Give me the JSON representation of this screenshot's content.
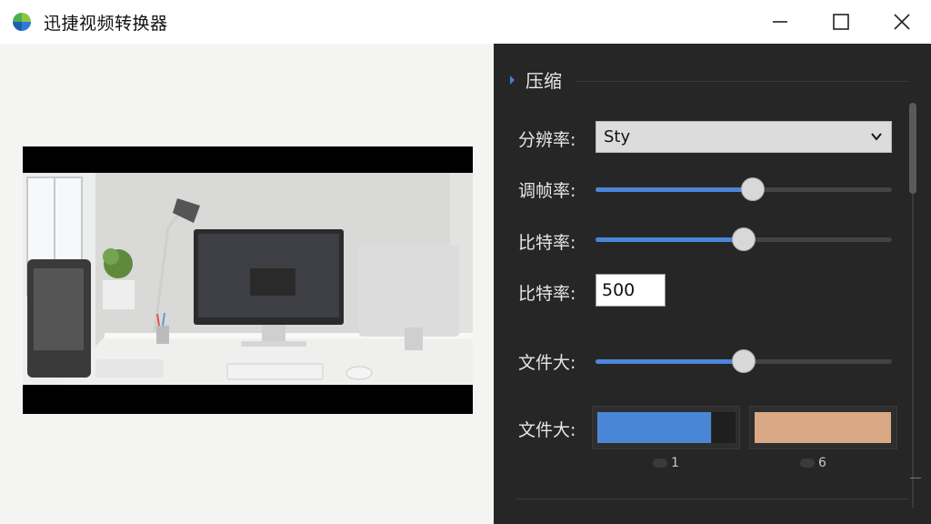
{
  "window": {
    "title": "迅捷视频转换器",
    "controls": {
      "minimize_icon": "minimize-icon",
      "maximize_icon": "maximize-icon",
      "close_icon": "close-icon"
    }
  },
  "preview": {
    "image": "office-desk-with-monitors"
  },
  "panel": {
    "section_title": "压缩",
    "resolution": {
      "label": "分辨率:",
      "value": "Sty"
    },
    "framerate": {
      "label": "调帧率:",
      "value": 0.53
    },
    "bitrate_slider": {
      "label": "比特率:",
      "value": 0.5
    },
    "bitrate_input": {
      "label": "比特率:",
      "value": "500"
    },
    "filesize_slider": {
      "label": "文件大:",
      "value": 0.5
    },
    "filesize_swatch": {
      "label": "文件大:",
      "swatch_a": {
        "color": "#4a86d6",
        "caption": "1"
      },
      "swatch_b": {
        "color": "#d9a884",
        "caption": "6"
      }
    }
  },
  "colors": {
    "accent": "#4a86d6",
    "panel_bg": "#262626"
  }
}
